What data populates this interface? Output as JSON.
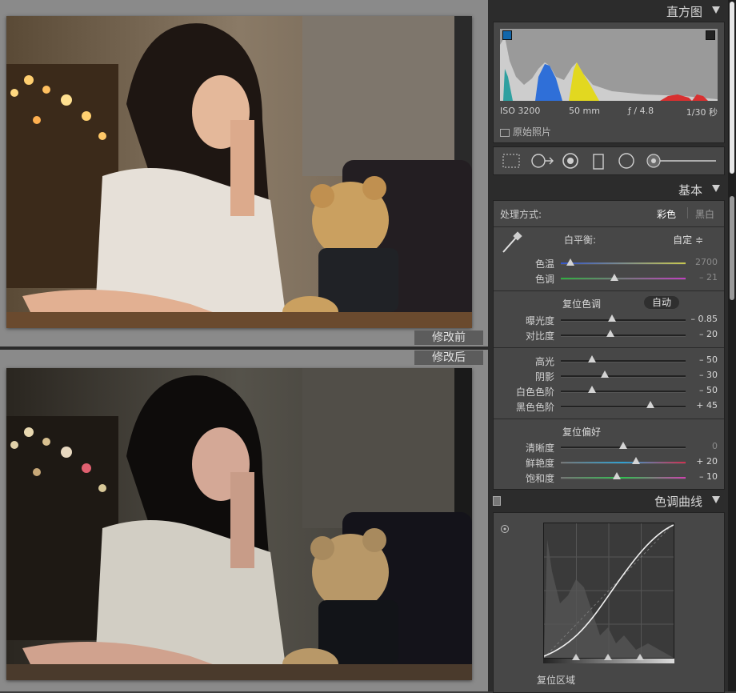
{
  "preview": {
    "label_before": "修改前",
    "label_after": "修改后"
  },
  "histogram": {
    "title": "直方图",
    "exif_iso": "ISO 3200",
    "exif_focal": "50 mm",
    "exif_aperture": "ƒ / 4.8",
    "exif_shutter": "1/30 秒",
    "original_photo_label": "原始照片"
  },
  "basic": {
    "title": "基本",
    "treatment_label": "处理方式:",
    "treatment_color": "彩色",
    "treatment_bw": "黑白",
    "wb_label": "白平衡:",
    "wb_value": "自定 ≑",
    "temp_label": "色温",
    "temp_value": "2700",
    "temp_pos": 0.08,
    "tint_label": "色调",
    "tint_value": "– 21",
    "tint_pos": 0.43,
    "tone_title": "复位色调",
    "auto_label": "自动",
    "exposure_label": "曝光度",
    "exposure_value": "– 0.85",
    "exposure_pos": 0.41,
    "contrast_label": "对比度",
    "contrast_value": "– 20",
    "contrast_pos": 0.4,
    "highlights_label": "高光",
    "highlights_value": "– 50",
    "highlights_pos": 0.25,
    "shadows_label": "阴影",
    "shadows_value": "– 30",
    "shadows_pos": 0.35,
    "whites_label": "白色色阶",
    "whites_value": "– 50",
    "whites_pos": 0.25,
    "blacks_label": "黑色色阶",
    "blacks_value": "+ 45",
    "blacks_pos": 0.72,
    "presence_title": "复位偏好",
    "clarity_label": "清晰度",
    "clarity_value": "0",
    "clarity_pos": 0.5,
    "vibrance_label": "鲜艳度",
    "vibrance_value": "+ 20",
    "vibrance_pos": 0.6,
    "saturation_label": "饱和度",
    "saturation_value": "– 10",
    "saturation_pos": 0.45
  },
  "curve": {
    "title": "色调曲线",
    "reset_region": "复位区域"
  },
  "colors": {
    "panel_bg": "#2c2c2c",
    "section_bg": "#474747",
    "preview_bg": "#8a8a8a"
  }
}
